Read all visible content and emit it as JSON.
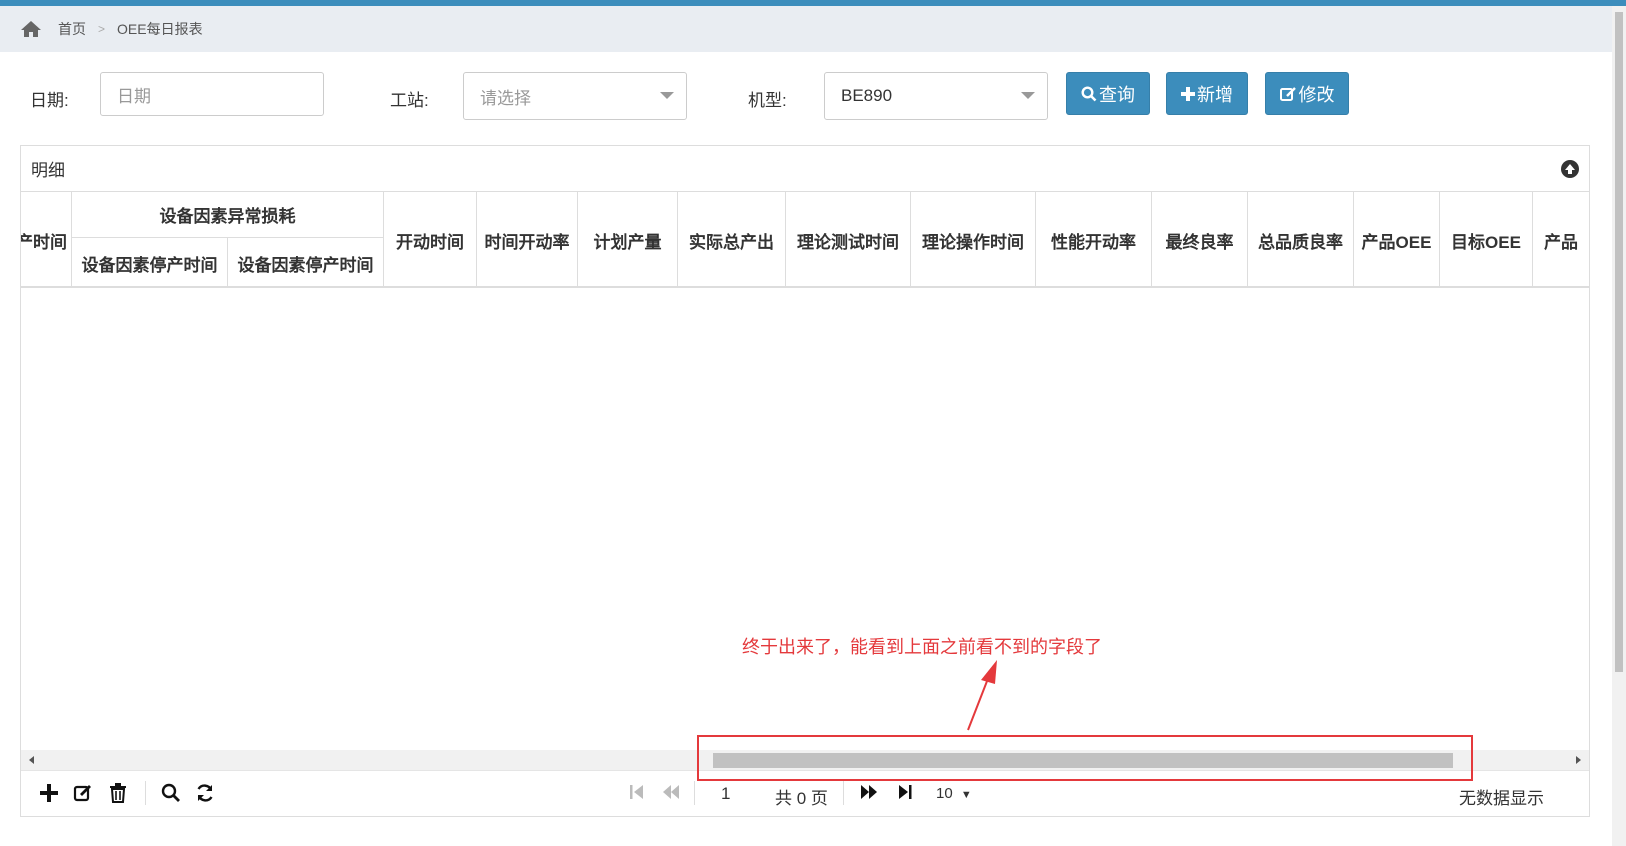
{
  "breadcrumb": {
    "home": "首页",
    "separator": ">",
    "current": "OEE每日报表"
  },
  "filter": {
    "date_label": "日期:",
    "date_placeholder": "日期",
    "station_label": "工站:",
    "station_placeholder": "请选择",
    "model_label": "机型:",
    "model_value": "BE890",
    "query_label": "查询",
    "add_label": "新增",
    "edit_label": "修改"
  },
  "panel": {
    "title": "明细",
    "columns": {
      "partial_first": "产时间",
      "group_header": "设备因素异常损耗",
      "sub1": "设备因素停产时间",
      "sub2": "设备因素停产时间",
      "c1": "开动时间",
      "c2": "时间开动率",
      "c3": "计划产量",
      "c4": "实际总产出",
      "c5": "理论测试时间",
      "c6": "理论操作时间",
      "c7": "性能开动率",
      "c8": "最终良率",
      "c9": "总品质良率",
      "c10": "产品OEE",
      "c11": "目标OEE",
      "c12": "产品"
    }
  },
  "pager": {
    "page": "1",
    "total": "共 0 页",
    "page_size": "10",
    "status": "无数据显示"
  },
  "annotation": {
    "text": "终于出来了，能看到上面之前看不到的字段了"
  }
}
